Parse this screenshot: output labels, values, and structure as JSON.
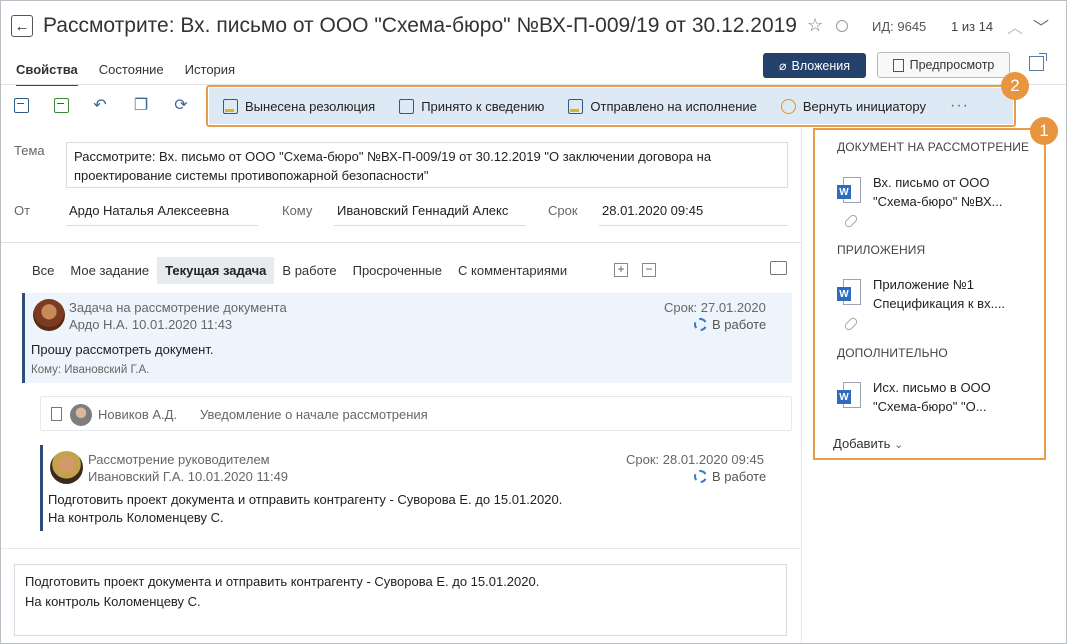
{
  "header": {
    "title": "Рассмотрите: Вх. письмо от ООО \"Схема-бюро\" №ВХ-П-009/19 от 30.12.2019 \"О ...",
    "doc_id": "ИД: 9645",
    "pager": "1 из 14"
  },
  "tabs": [
    {
      "label": "Свойства",
      "active": true
    },
    {
      "label": "Состояние",
      "active": false
    },
    {
      "label": "История",
      "active": false
    }
  ],
  "buttons": {
    "attachments": "Вложения",
    "preview": "Предпросмотр"
  },
  "actions": [
    {
      "label": "Вынесена резолюция",
      "icon": "resolution-icon"
    },
    {
      "label": "Принято к сведению",
      "icon": "envelope-check-icon"
    },
    {
      "label": "Отправлено на исполнение",
      "icon": "calendar-check-icon"
    },
    {
      "label": "Вернуть инициатору",
      "icon": "return-icon"
    }
  ],
  "actions_more": "···",
  "badges": {
    "right_panel": "1",
    "actions": "2"
  },
  "fields": {
    "theme_label": "Тема",
    "theme_value": "Рассмотрите: Вх. письмо от ООО \"Схема-бюро\" №ВХ-П-009/19 от 30.12.2019 \"О заключении договора на проектирование системы противопожарной безопасности\"",
    "from_label": "От",
    "from_value": "Ардо Наталья Алексеевна",
    "to_label": "Кому",
    "to_value": "Ивановский Геннадий Алекс",
    "due_label": "Срок",
    "due_value": "28.01.2020 09:45"
  },
  "filters": [
    {
      "label": "Все",
      "active": false
    },
    {
      "label": "Мое задание",
      "active": false
    },
    {
      "label": "Текущая задача",
      "active": true
    },
    {
      "label": "В работе",
      "active": false
    },
    {
      "label": "Просроченные",
      "active": false
    },
    {
      "label": "С комментариями",
      "active": false
    }
  ],
  "tasks": {
    "task1": {
      "title": "Задача на рассмотрение документа",
      "author": "Ардо Н.А.  10.01.2020 11:43",
      "due": "Срок: 27.01.2020",
      "status": "В работе",
      "body": "Прошу рассмотреть документ.",
      "to": "Кому: Ивановский Г.А."
    },
    "notification": {
      "author": "Новиков А.Д.",
      "text": "Уведомление о начале рассмотрения"
    },
    "task2": {
      "title": "Рассмотрение руководителем",
      "author": "Ивановский Г.А.  10.01.2020 11:49",
      "due": "Срок: 28.01.2020 09:45",
      "status": "В работе",
      "body_line1": "Подготовить проект документа и отправить контрагенту - Суворова Е. до 15.01.2020.",
      "body_line2": "На контроль Коломенцеву С."
    }
  },
  "bottom_text": {
    "line1": "Подготовить проект документа и отправить контрагенту - Суворова Е. до 15.01.2020.",
    "line2": "На контроль Коломенцеву С."
  },
  "right_panel": {
    "section1": "ДОКУМЕНТ НА РАССМОТРЕНИЕ",
    "doc1_line1": "Вх. письмо от ООО",
    "doc1_line2": "\"Схема-бюро\" №ВХ...",
    "section2": "ПРИЛОЖЕНИЯ",
    "doc2_line1": "Приложение №1",
    "doc2_line2": "Спецификация к вх....",
    "section3": "ДОПОЛНИТЕЛЬНО",
    "doc3_line1": "Исх. письмо в ООО",
    "doc3_line2": "\"Схема-бюро\" \"О...",
    "add": "Добавить"
  },
  "colors": {
    "accent_navy": "#23416b",
    "highlight_orange": "#e89c4d",
    "toolbar_bg": "#dde9f4",
    "word_blue": "#2f6bbf"
  }
}
